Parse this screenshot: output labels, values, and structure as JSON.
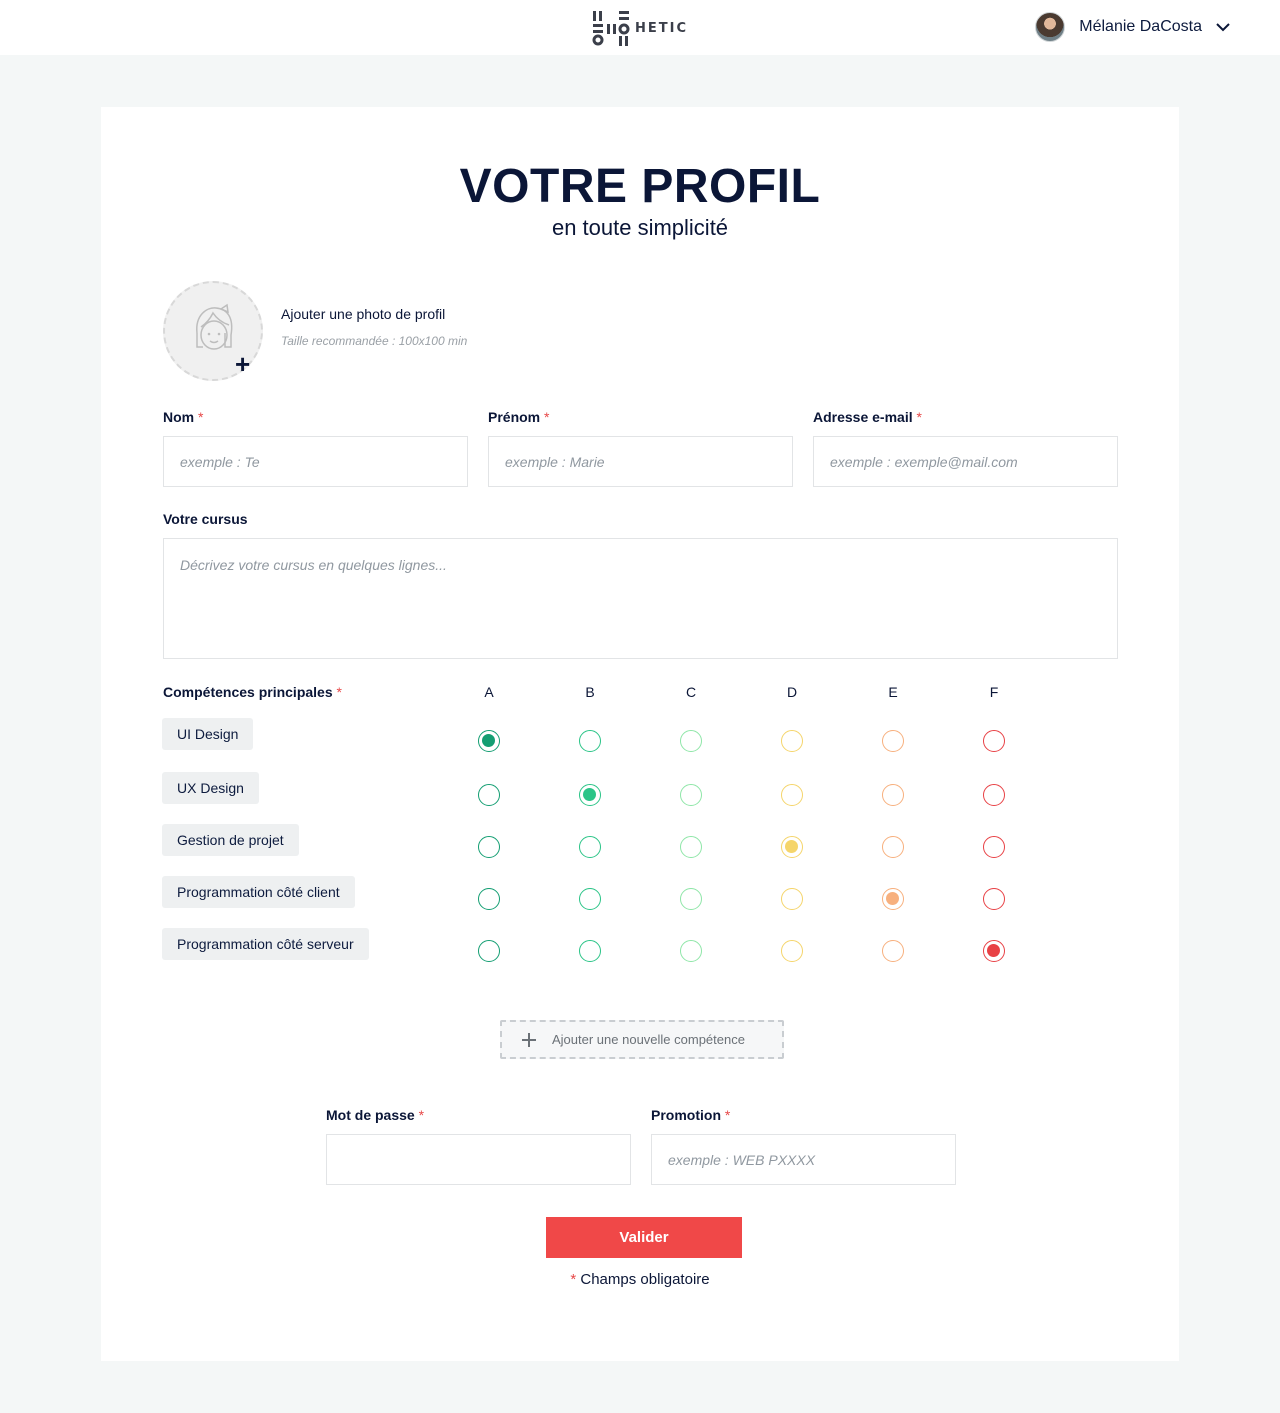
{
  "header": {
    "brand": "HETIC",
    "user_name": "Mélanie DaCosta"
  },
  "page": {
    "title": "VOTRE PROFIL",
    "subtitle": "en toute simplicité"
  },
  "photo": {
    "title": "Ajouter une photo de profil",
    "hint": "Taille recommandée : 100x100 min"
  },
  "required_mark": "*",
  "fields": {
    "nom": {
      "label": "Nom",
      "placeholder": "exemple : Te"
    },
    "prenom": {
      "label": "Prénom",
      "placeholder": "exemple : Marie"
    },
    "email": {
      "label": "Adresse e-mail",
      "placeholder": "exemple : exemple@mail.com"
    },
    "cursus": {
      "label": "Votre cursus",
      "placeholder": "Décrivez votre cursus en quelques lignes..."
    },
    "password": {
      "label": "Mot de passe",
      "placeholder": ""
    },
    "promotion": {
      "label": "Promotion",
      "placeholder": "exemple : WEB PXXXX"
    }
  },
  "skills": {
    "label": "Compétences principales",
    "levels": [
      "A",
      "B",
      "C",
      "D",
      "E",
      "F"
    ],
    "level_colors": [
      "#139e72",
      "#2bc487",
      "#8fe6a8",
      "#f5d56b",
      "#f7b07e",
      "#e84145"
    ],
    "rows": [
      {
        "name": "UI Design",
        "selected": "A"
      },
      {
        "name": "UX Design",
        "selected": "B"
      },
      {
        "name": "Gestion de projet",
        "selected": "D"
      },
      {
        "name": "Programmation côté client",
        "selected": "E"
      },
      {
        "name": "Programmation côté serveur",
        "selected": "F"
      }
    ],
    "add_label": "Ajouter une nouvelle compétence"
  },
  "actions": {
    "submit": "Valider",
    "mandatory_note": "Champs obligatoire"
  }
}
